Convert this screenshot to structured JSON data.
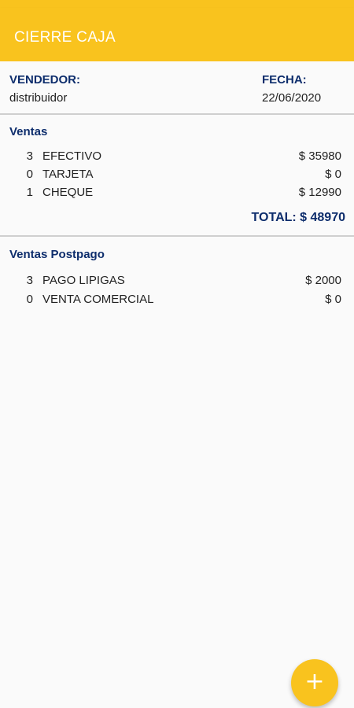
{
  "app": {
    "title": "CIERRE CAJA"
  },
  "header": {
    "vendedor_label": "VENDEDOR:",
    "vendedor_value": "distribuidor",
    "fecha_label": "FECHA:",
    "fecha_value": "22/06/2020"
  },
  "ventas": {
    "title": "Ventas",
    "rows": [
      {
        "qty": "3",
        "name": "EFECTIVO",
        "amount": "$ 35980"
      },
      {
        "qty": "0",
        "name": "TARJETA",
        "amount": "$ 0"
      },
      {
        "qty": "1",
        "name": "CHEQUE",
        "amount": "$ 12990"
      }
    ],
    "total": "TOTAL: $ 48970"
  },
  "postpago": {
    "title": "Ventas Postpago",
    "rows": [
      {
        "qty": "3",
        "name": "PAGO LIPIGAS",
        "amount": "$ 2000"
      },
      {
        "qty": "0",
        "name": "VENTA COMERCIAL",
        "amount": "$ 0"
      }
    ]
  },
  "fab": {
    "icon": "plus-icon",
    "label": "+"
  },
  "colors": {
    "accent": "#f9c31e",
    "heading": "#0d2d6c"
  }
}
